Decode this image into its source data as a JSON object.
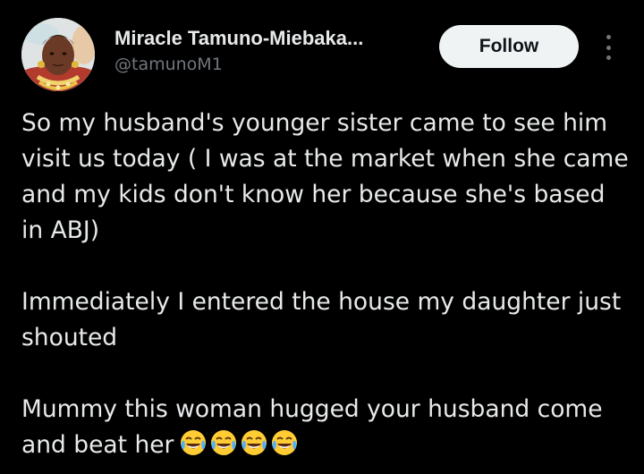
{
  "author": {
    "display_name": "Miracle Tamuno-Miebaka...",
    "handle": "@tamunoM1",
    "avatar_icon": "profile-photo"
  },
  "actions": {
    "follow_label": "Follow",
    "more_icon": "more-vertical-icon"
  },
  "tweet": {
    "paragraph_1": "So my husband's younger sister came to see him visit us today ( I was at the market when she came and my kids don't know her because she's based in ABJ)",
    "paragraph_2": "Immediately I entered the house my daughter just shouted",
    "paragraph_3": "Mummy this woman hugged your husband come and beat her",
    "trailing_emoji": "😂😂😂😂",
    "emoji_icon": "tears-of-joy-emoji"
  },
  "colors": {
    "background": "#000000",
    "primary_text": "#e7e9ea",
    "secondary_text": "#71767b",
    "follow_button_bg": "#eff3f4",
    "follow_button_text": "#0f1419"
  }
}
